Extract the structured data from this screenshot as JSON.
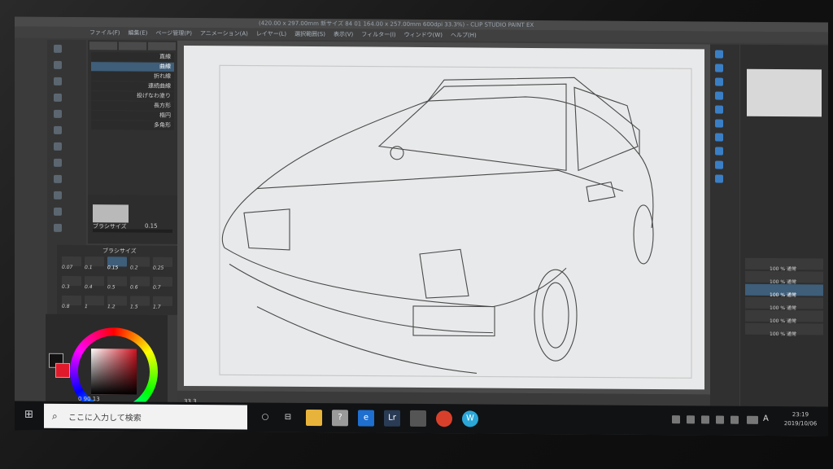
{
  "window": {
    "title": "(420.00 x 297.00mm 新サイズ 84 01 164.00 x 257.00mm 600dpi 33.3%) - CLIP STUDIO PAINT EX"
  },
  "menu": {
    "items": [
      "ファイル(F)",
      "編集(E)",
      "ページ管理(P)",
      "アニメーション(A)",
      "レイヤー(L)",
      "選択範囲(S)",
      "表示(V)",
      "フィルター(I)",
      "ウィンドウ(W)",
      "ヘルプ(H)"
    ]
  },
  "subtool": {
    "items": [
      "直線",
      "曲線",
      "折れ線",
      "連続曲線",
      "投げなわ塗り",
      "長方形",
      "楕円",
      "多角形"
    ]
  },
  "tool_property": {
    "brush_size_label": "ブラシサイズ",
    "brush_size_value": "0.15"
  },
  "brush_size_panel": {
    "label": "ブラシサイズ",
    "values": [
      "0.07",
      "0.1",
      "0.15",
      "0.2",
      "0.25",
      "0.3",
      "0.4",
      "0.5",
      "0.6",
      "0.7",
      "0.8",
      "1",
      "1.2",
      "1.5",
      "1.7"
    ]
  },
  "color": {
    "foreground": "#111111",
    "background": "#e01a2a",
    "hsv_readout": "0  90  13"
  },
  "status": {
    "zoom": "33.3"
  },
  "layers": {
    "items": [
      "100 % 通常",
      "100 % 通常",
      "100 % 通常",
      "100 % 通常",
      "100 % 通常",
      "100 % 通常"
    ]
  },
  "taskbar": {
    "search_placeholder": "ここに入力して検索",
    "apps": [
      {
        "name": "explorer",
        "color": "#e8b33a"
      },
      {
        "name": "clip-studio",
        "color": "#9a9a9a",
        "glyph": "?"
      },
      {
        "name": "edge",
        "color": "#1e6fd0",
        "glyph": "e"
      },
      {
        "name": "lightroom",
        "color": "#2a3b55",
        "glyph": "Lr"
      },
      {
        "name": "camera",
        "color": "#555555"
      },
      {
        "name": "chrome",
        "color": "#d9402b"
      },
      {
        "name": "app-w",
        "color": "#2aa6d8",
        "glyph": "W"
      }
    ],
    "ime": "A",
    "time": "23:19",
    "date": "2019/10/06"
  }
}
